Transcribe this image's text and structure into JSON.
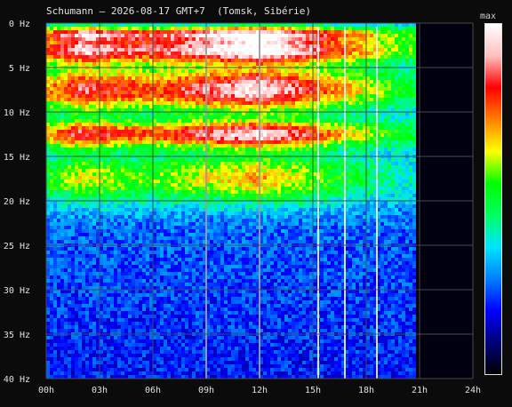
{
  "chart_data": {
    "type": "heatmap",
    "title": "Schumann – 2026-08-17 GMT+7  (Tomsk, Sibérie)",
    "x_ticks": [
      "00h",
      "03h",
      "06h",
      "09h",
      "12h",
      "15h",
      "18h",
      "21h",
      "24h"
    ],
    "y_ticks": [
      "0 Hz",
      "5 Hz",
      "10 Hz",
      "15 Hz",
      "20 Hz",
      "25 Hz",
      "30 Hz",
      "35 Hz",
      "40 Hz"
    ],
    "x_range_hours": [
      0,
      24
    ],
    "y_range_hz": [
      0,
      40
    ],
    "y_direction": "0 Hz at top, 40 Hz at bottom",
    "data_end_hour": 20.8,
    "colorbar_label": "max",
    "colormap": [
      "#000000",
      "#00007a",
      "#0000ff",
      "#0080ff",
      "#00e5ff",
      "#00ff60",
      "#00ff00",
      "#ffff00",
      "#ff8000",
      "#ff0000",
      "#ffc0c0",
      "#ffffff"
    ],
    "grid": true,
    "schumann_bands_hz": [
      {
        "center": 3,
        "width": 1.5,
        "intensity": 0.78
      },
      {
        "center": 7.5,
        "width": 2.5,
        "intensity": 0.72
      },
      {
        "center": 12.5,
        "width": 1.5,
        "intensity": 0.7
      },
      {
        "center": 1.2,
        "width": 0.8,
        "intensity": 0.6
      },
      {
        "center": 17.5,
        "width": 3,
        "intensity": 0.45
      }
    ],
    "vertical_spikes_hour": [
      9.0,
      12.0,
      15.3,
      16.8,
      18.6
    ],
    "activity_by_hour": [
      {
        "hour": 0,
        "level": 0.55
      },
      {
        "hour": 2,
        "level": 0.8
      },
      {
        "hour": 4,
        "level": 0.7
      },
      {
        "hour": 6,
        "level": 0.65
      },
      {
        "hour": 8,
        "level": 0.75
      },
      {
        "hour": 10,
        "level": 0.85
      },
      {
        "hour": 12,
        "level": 0.95
      },
      {
        "hour": 14,
        "level": 0.8
      },
      {
        "hour": 16,
        "level": 0.6
      },
      {
        "hour": 18,
        "level": 0.45
      },
      {
        "hour": 20,
        "level": 0.3
      },
      {
        "hour": 24,
        "level": 0.25
      }
    ]
  }
}
